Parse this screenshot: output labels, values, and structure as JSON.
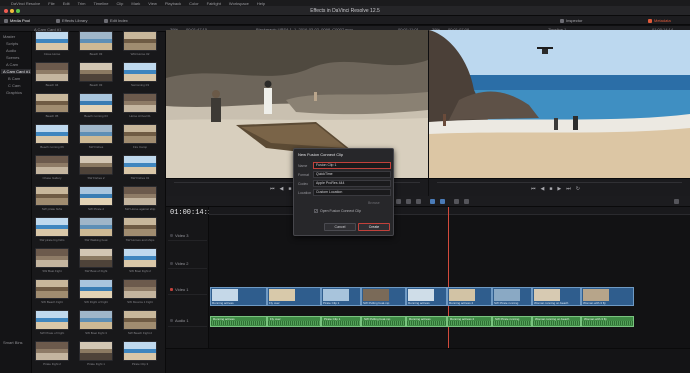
{
  "menubar": {
    "items": [
      "DaVinci Resolve",
      "File",
      "Edit",
      "Trim",
      "Timeline",
      "Clip",
      "Mark",
      "View",
      "Playback",
      "Color",
      "Fairlight",
      "Workspace",
      "Help"
    ]
  },
  "window": {
    "title": "Effects in DaVinci Resolve 12.5"
  },
  "toolbar": {
    "media_pool": "Media Pool",
    "effects_library": "Effects Library",
    "edit_index": "Edit Index",
    "inspector": "Inspector",
    "metadata": "Metadata"
  },
  "subbar": {
    "bin_name": "A Cam Card #1",
    "zoom_left": "39%",
    "tc_left": "00:01:47:15",
    "clip_name": "Blackmagic URSA 1_1_2016-03-02_0098_C0007.mov",
    "tc_mid": "00:01:11:01",
    "zoom_right": "39%",
    "tc_right": "00:01:07:08",
    "timeline_name": "Timeline 1",
    "tc_far": "01:00:14:14"
  },
  "sidebar": {
    "items": [
      "Master",
      "Scripts",
      "Audio",
      "Scenes",
      "A Cam",
      "A Cam Card #1",
      "B Cam",
      "C Cam",
      "Graphics"
    ],
    "selected": 5,
    "smart_bins": "Smart Bins"
  },
  "media_pool": {
    "clips": [
      "Close Horse",
      "Beach 03",
      "Wild Horse 02",
      "Beach 04",
      "Beach 03",
      "Swimming 03",
      "Beach 05",
      "Beach running 03",
      "Horse Arrival 01",
      "Beach running 06",
      "SW Fishes",
      "Fire Camp",
      "Chase Gallery",
      "SW Fishes 2",
      "SW Fishes 01",
      "SW pirate fishs",
      "SW Pirate 2",
      "SW Horse against ship",
      "SW pirate big fishs",
      "SW Walking boat",
      "SW Horses and ships",
      "SW Boat Fight",
      "SW Boat of Fight",
      "SW Boat Fight 2",
      "SW Beach Fight",
      "SW Flight of Fight",
      "SW Moonta 1 Fight",
      "SW Pirate of Fight",
      "SW Boat Fight 3",
      "SW Beach Fight 2",
      "Pirate Fight 2",
      "Pirate Fight 1",
      "Pirate Clip 3"
    ]
  },
  "viewer": {
    "timecode": "01:00:14:14"
  },
  "timeline": {
    "tracks": [
      "Video 3",
      "Video 2",
      "Video 1",
      "Audio 1"
    ],
    "video_clips": [
      "Running actress",
      "Fly over",
      "Pirate Clip 1",
      "SW Pulling boat.mp",
      "Running actress",
      "Running actress 2",
      "SW Pirate running",
      "Woman running on beach",
      "Woman with 3 fly"
    ],
    "audio_clips": [
      "Running actress",
      "Fly over",
      "Pirate Clip 1",
      "SW Pulling boat.mp",
      "Running actress",
      "Running actress 2",
      "SW Pirate running",
      "Woman running on beach",
      "Woman with 3 fly"
    ]
  },
  "dialog": {
    "title": "New Fusion Connect Clip",
    "name_label": "Name",
    "name_value": "Fusion Clip 1",
    "format_label": "Format",
    "format_value": "QuickTime",
    "codec_label": "Codec",
    "codec_value": "Apple ProRes 444",
    "location_label": "Location",
    "location_value": "Custom Location",
    "browse": "Browse",
    "checkbox_label": "Open Fusion Connect Clip",
    "cancel": "Cancel",
    "create": "Create"
  },
  "colors": {
    "accent_red": "#c2413b",
    "video_clip": "#2f5d8d",
    "audio_clip": "#3f8a45"
  }
}
